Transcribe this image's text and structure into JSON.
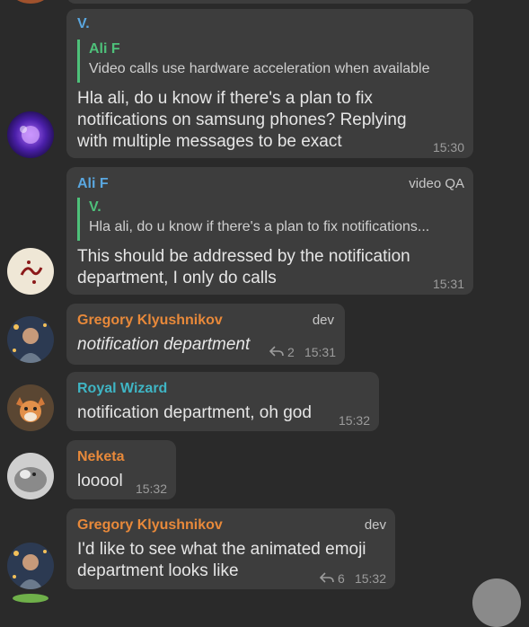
{
  "messages": [
    {
      "sender": "V.",
      "sender_color": "#5aa7e0",
      "quote": {
        "name": "Ali F",
        "text": "Video calls use hardware acceleration when available"
      },
      "text_lines": [
        "Hla ali, do u know if there's a plan to fix",
        "notifications on samsung phones? Replying",
        "with multiple messages to be exact"
      ],
      "time": "15:30"
    },
    {
      "sender": "Ali F",
      "sender_color": "#5aa7e0",
      "rank": "video QA",
      "quote": {
        "name": "V.",
        "text": "Hla ali, do u know if there's a plan to fix notifications..."
      },
      "text_lines": [
        "This should be addressed by the notification",
        "department, I only do calls"
      ],
      "time": "15:31"
    },
    {
      "sender": "Gregory Klyushnikov",
      "sender_color": "#e8893a",
      "rank": "dev",
      "text_lines": [
        "notification department"
      ],
      "replies": "2",
      "time": "15:31"
    },
    {
      "sender": "Royal Wizard",
      "sender_color": "#3fb5c4",
      "text_lines": [
        "notification department, oh god"
      ],
      "time": "15:32"
    },
    {
      "sender": "Neketa",
      "sender_color": "#e8893a",
      "text_lines": [
        "looool"
      ],
      "time": "15:32"
    },
    {
      "sender": "Gregory Klyushnikov",
      "sender_color": "#e8893a",
      "rank": "dev",
      "text_lines": [
        "I'd like to see what the animated emoji",
        "department looks like"
      ],
      "replies": "6",
      "time": "15:32"
    }
  ],
  "icons": {
    "reply": "reply-arrow-icon",
    "scroll_down": "scroll-down-button"
  },
  "colors": {
    "background": "#2a2a2a",
    "bubble": "#3d3d3d",
    "quote_bar": "#4ec17a"
  }
}
